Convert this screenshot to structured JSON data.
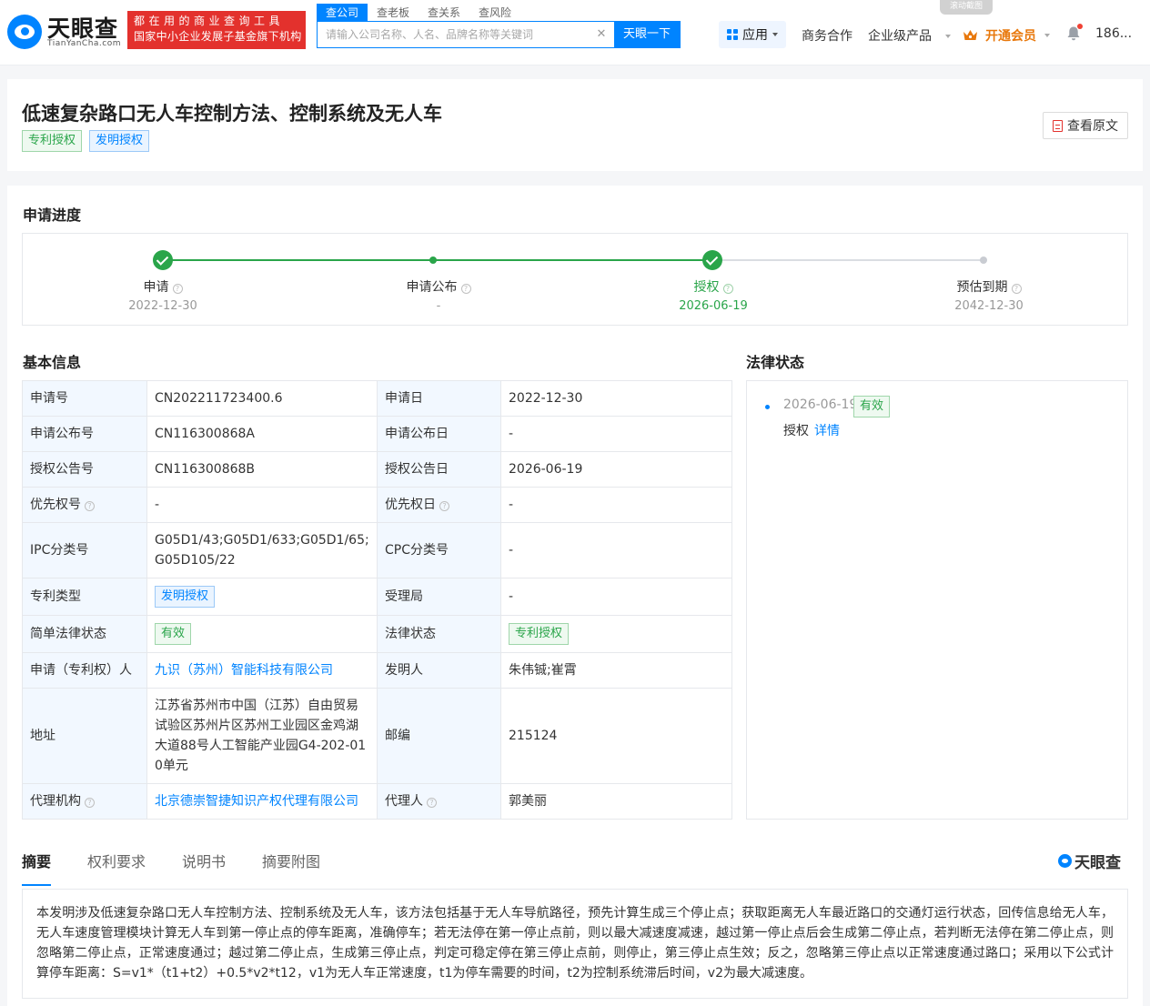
{
  "header": {
    "logo_name": "天眼查",
    "logo_sub": "TianYanCha.com",
    "slogan_line1": "都在用的商业查询工具",
    "slogan_line2": "国家中小企业发展子基金旗下机构",
    "search_tabs": [
      "查公司",
      "查老板",
      "查关系",
      "查风险"
    ],
    "search_placeholder": "请输入公司名称、人名、品牌名称等关键词",
    "search_button": "天眼一下",
    "float_tip": "滚动截图",
    "nav_apps": "应用",
    "nav_business": "商务合作",
    "nav_enterprise": "企业级产品",
    "nav_vip": "开通会员",
    "nav_user": "186..."
  },
  "patent": {
    "title": "低速复杂路口无人车控制方法、控制系统及无人车",
    "tags": [
      "专利授权",
      "发明授权"
    ],
    "view_original": "查看原文"
  },
  "progress": {
    "section_title": "申请进度",
    "progress_fraction": 0.75,
    "steps": [
      {
        "label": "申请",
        "date": "2022-12-30",
        "status": "done"
      },
      {
        "label": "申请公布",
        "date": "-",
        "status": "passed"
      },
      {
        "label": "授权",
        "date": "2026-06-19",
        "status": "current"
      },
      {
        "label": "预估到期",
        "date": "2042-12-30",
        "status": "pending"
      }
    ]
  },
  "basic_info": {
    "section_title": "基本信息",
    "rows": [
      {
        "k1": "申请号",
        "v1": "CN202211723400.6",
        "k2": "申请日",
        "v2": "2022-12-30"
      },
      {
        "k1": "申请公布号",
        "v1": "CN116300868A",
        "k2": "申请公布日",
        "v2": "-"
      },
      {
        "k1": "授权公告号",
        "v1": "CN116300868B",
        "k2": "授权公告日",
        "v2": "2026-06-19"
      },
      {
        "k1": "优先权号",
        "v1": "-",
        "k2": "优先权日",
        "v2": "-"
      },
      {
        "k1": "IPC分类号",
        "v1": "G05D1/43;G05D1/633;G05D1/65;G05D105/22",
        "k2": "CPC分类号",
        "v2": "-"
      },
      {
        "k1": "专利类型",
        "v1": "发明授权",
        "k2": "受理局",
        "v2": "-"
      },
      {
        "k1": "简单法律状态",
        "v1": "有效",
        "k2": "法律状态",
        "v2": "专利授权"
      },
      {
        "k1": "申请（专利权）人",
        "v1": "九识（苏州）智能科技有限公司",
        "k2": "发明人",
        "v2": "朱伟铖;崔霄"
      },
      {
        "k1": "地址",
        "v1": "江苏省苏州市中国（江苏）自由贸易试验区苏州片区苏州工业园区金鸡湖大道88号人工智能产业园G4-202-010单元",
        "k2": "邮编",
        "v2": "215124"
      },
      {
        "k1": "代理机构",
        "v1": "北京德崇智捷知识产权代理有限公司",
        "k2": "代理人",
        "v2": "郭美丽"
      }
    ]
  },
  "legal_status": {
    "section_title": "法律状态",
    "date": "2026-06-19",
    "tag": "有效",
    "action": "授权",
    "detail_link": "详情"
  },
  "content_tabs": [
    "摘要",
    "权利要求",
    "说明书",
    "摘要附图"
  ],
  "watermark": "天眼查",
  "abstract": "本发明涉及低速复杂路口无人车控制方法、控制系统及无人车，该方法包括基于无人车导航路径，预先计算生成三个停止点；获取距离无人车最近路口的交通灯运行状态，回传信息给无人车，无人车速度管理模块计算无人车到第一停止点的停车距离，准确停车；若无法停在第一停止点前，则以最大减速度减速，越过第一停止点后会生成第二停止点，若判断无法停在第二停止点，则忽略第二停止点，正常速度通过；越过第二停止点，生成第三停止点，判定可稳定停在第三停止点前，则停止，第三停止点生效；反之，忽略第三停止点以正常速度通过路口；采用以下公式计算停车距离：S=v1*（t1+t2）+0.5*v2*t12，v1为无人车正常速度，t1为停车需要的时间，t2为控制系统滞后时间，v2为最大减速度。",
  "colors": {
    "brand_blue": "#0084ff",
    "green": "#2aa54a",
    "slogan_red": "#e3312d",
    "vip_orange": "#e8780c"
  }
}
